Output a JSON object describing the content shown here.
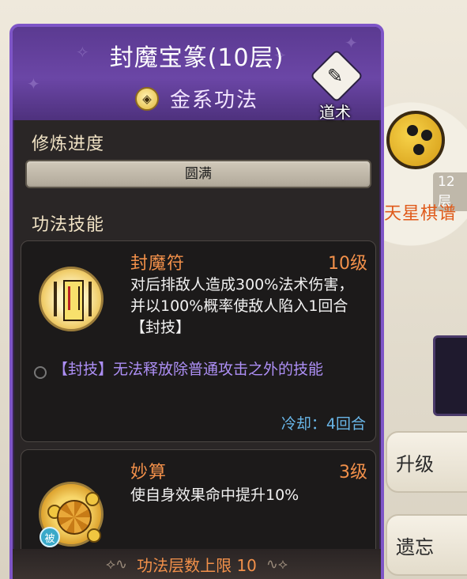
{
  "background": {
    "item_level": "12层",
    "item_name": "天星棋谱"
  },
  "panel": {
    "title": "封魔宝篆(10层)",
    "element": {
      "label": "金系功法",
      "icon": "gold-element-icon"
    },
    "type_badge": {
      "label": "道术",
      "icon": "scroll-icon"
    },
    "cultivation": {
      "section_label": "修炼进度",
      "progress_text": "圆满",
      "progress_fraction": 1.0
    },
    "skills_section_label": "功法技能",
    "skills": [
      {
        "name": "封魔符",
        "level": "10级",
        "description": "对后排敌人造成300%法术伤害，并以100%概率使敌人陷入1回合【封技】",
        "status_note": "【封技】无法释放除普通攻击之外的技能",
        "cooldown": "冷却：4回合",
        "icon": "seal-talisman-icon"
      },
      {
        "name": "妙算",
        "level": "3级",
        "description": "使自身效果命中提升10%",
        "passive_tag": "被",
        "icon": "turtle-shell-icon"
      }
    ],
    "footer": "功法层数上限 10"
  },
  "actions": {
    "upgrade": "升级",
    "forget": "遗忘"
  },
  "colors": {
    "header_purple": "#6b46a6",
    "border_purple": "#7e55c7",
    "skill_orange": "#f2904a",
    "status_purple": "#ad8ff5",
    "cooldown_blue": "#69b6e8"
  }
}
